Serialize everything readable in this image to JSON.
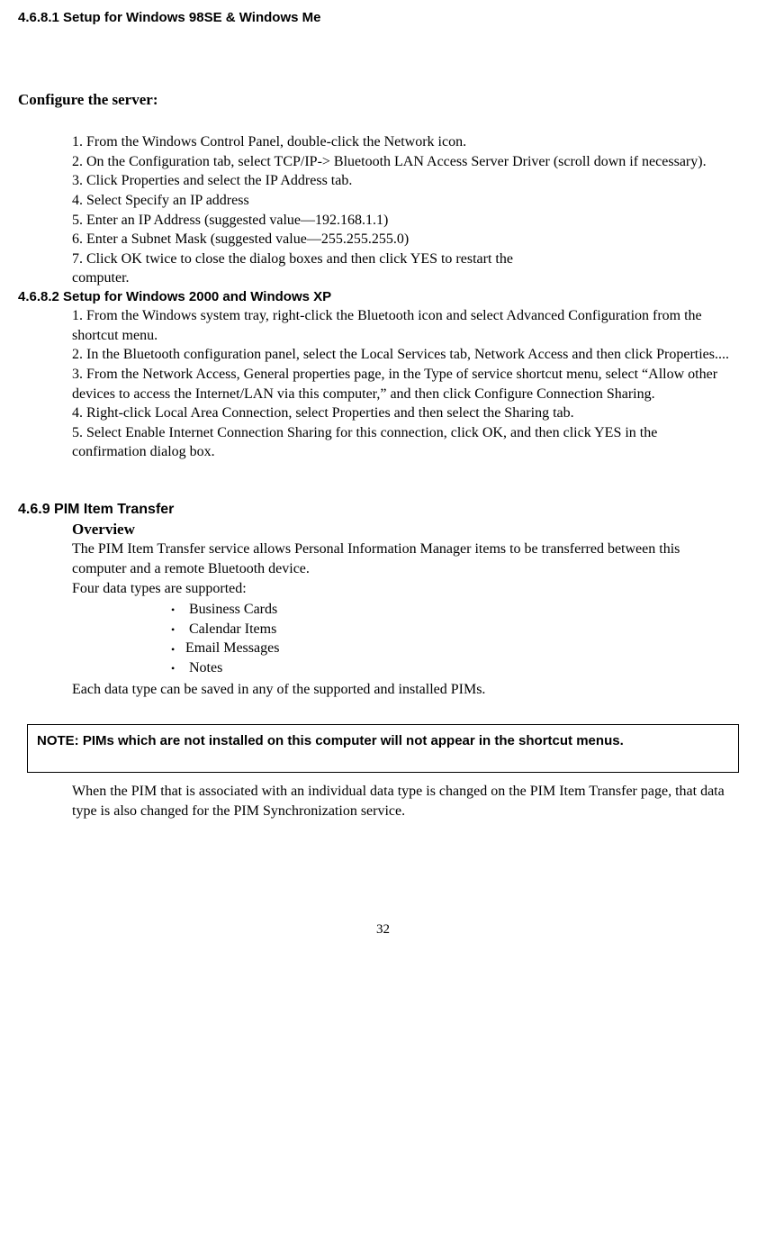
{
  "headings": {
    "h4681": "4.6.8.1 Setup for Windows 98SE & Windows Me",
    "configure": "Configure the server:",
    "h4682": "4.6.8.2 Setup for Windows 2000 and Windows XP",
    "h469": "4.6.9 PIM Item Transfer",
    "overview": "Overview"
  },
  "steps_a": {
    "s1": "1. From the Windows Control Panel, double-click the Network icon.",
    "s2": "2. On the Configuration tab, select TCP/IP-> Bluetooth LAN Access Server Driver (scroll down if necessary).",
    "s3": "3. Click Properties and select the IP Address tab.",
    "s4": "4. Select Specify an IP address",
    "s5": "5. Enter an IP Address (suggested value—192.168.1.1)",
    "s6": "6. Enter a Subnet Mask (suggested value—255.255.255.0)",
    "s7": "7. Click OK twice to close the dialog boxes and then click YES to restart the",
    "s7b": " computer."
  },
  "steps_b": {
    "s1": "1. From the Windows system tray, right-click the Bluetooth icon and select Advanced Configuration from the shortcut menu.",
    "s2": "2. In the Bluetooth configuration panel, select the Local Services tab, Network Access and then click Properties....",
    "s3": "3. From the Network Access, General properties page, in the Type of service shortcut menu, select “Allow other devices to access the Internet/LAN via this computer,” and then click Configure Connection Sharing.",
    "s4": "4. Right-click Local Area Connection, select Properties and then select the Sharing tab.",
    "s5": "5. Select Enable Internet Connection Sharing for this connection, click OK, and then click YES in the confirmation dialog box."
  },
  "pim": {
    "p1": "The PIM Item Transfer service allows Personal Information Manager items to be transferred between this computer and a remote Bluetooth device.",
    "p2": "Four data types are supported:",
    "bullets": {
      "b1": " Business Cards",
      "b2": " Calendar Items",
      "b3": "Email Messages",
      "b4": " Notes"
    },
    "p3": "Each data type can be saved in any of the supported and installed PIMs.",
    "p4": "When the PIM that is associated with an individual data type is changed on the PIM Item Transfer page, that data type is also changed for the PIM Synchronization service."
  },
  "note": "NOTE: PIMs which are not installed on this computer will not appear in the shortcut menus.",
  "page_number": "32"
}
